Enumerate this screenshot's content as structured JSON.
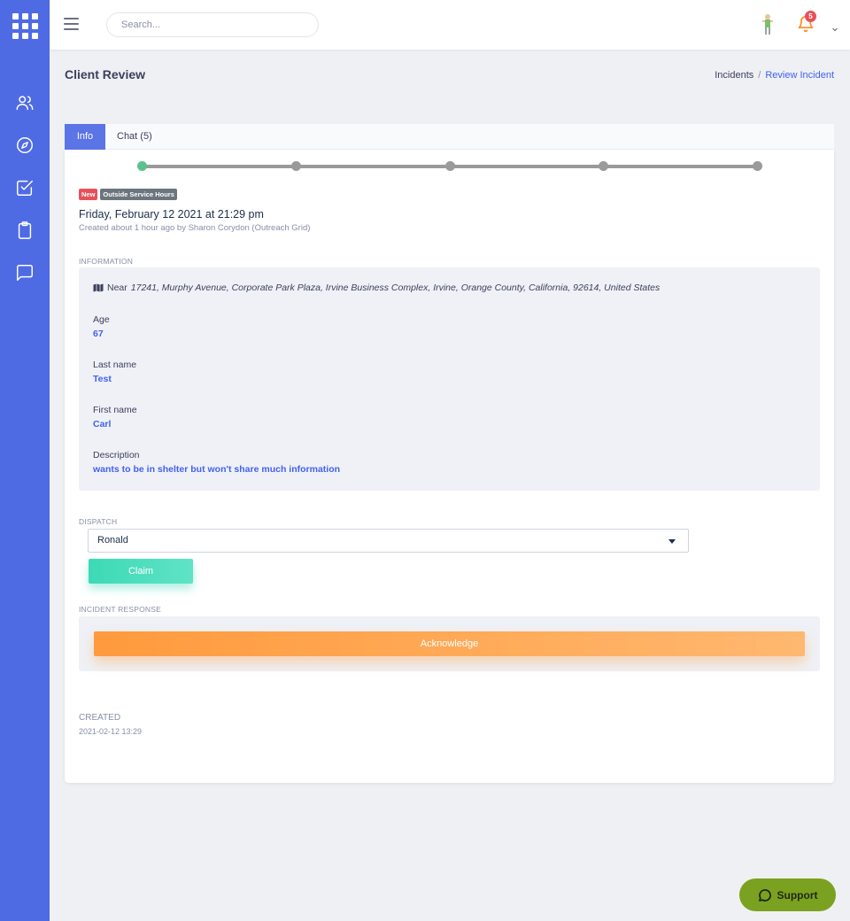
{
  "topbar": {
    "search_placeholder": "Search...",
    "notification_count": "5"
  },
  "page": {
    "title": "Client Review",
    "breadcrumb": [
      {
        "label": "Incidents"
      },
      {
        "label": "Review Incident"
      }
    ],
    "breadcrumb_separator": "/"
  },
  "tabs": [
    {
      "label": "Info",
      "active": true
    },
    {
      "label": "Chat (5)",
      "active": false
    }
  ],
  "progress": {
    "total_steps": 5,
    "completed_steps": 1
  },
  "incident": {
    "badges": [
      "New",
      "Outside Service Hours"
    ],
    "date": "Friday, February 12 2021 at 21:29 pm",
    "created_by": "Created about 1 hour ago by Sharon Corydon (Outreach Grid)"
  },
  "information": {
    "label": "Information",
    "address_prefix": "Near",
    "address": "17241, Murphy Avenue, Corporate Park Plaza, Irvine Business Complex, Irvine, Orange County, California, 92614, United States",
    "fields": [
      {
        "label": "Age",
        "value": "67"
      },
      {
        "label": "Last name",
        "value": "Test"
      },
      {
        "label": "First name",
        "value": "Carl"
      },
      {
        "label": "Description",
        "value": "wants to be in shelter but won't share much information"
      }
    ]
  },
  "dispatch": {
    "label": "Dispatch",
    "selected": "Ronald",
    "claim_label": "Claim"
  },
  "incident_response": {
    "label": "Incident Response",
    "acknowledge_label": "Acknowledge"
  },
  "created": {
    "label": "Created",
    "value": "2021-02-12 13:29"
  },
  "support": {
    "label": "Support"
  },
  "colors": {
    "sidebar": "#4f6be4",
    "accent": "#4361ee",
    "claim": "#3dd9b6",
    "acknowledge": "#ff9a3d",
    "support": "#7ba120",
    "badge_new": "#e7515a",
    "badge_hours": "#6c757d",
    "step_done": "#59c38a",
    "step_pending": "#9a9a9a"
  }
}
